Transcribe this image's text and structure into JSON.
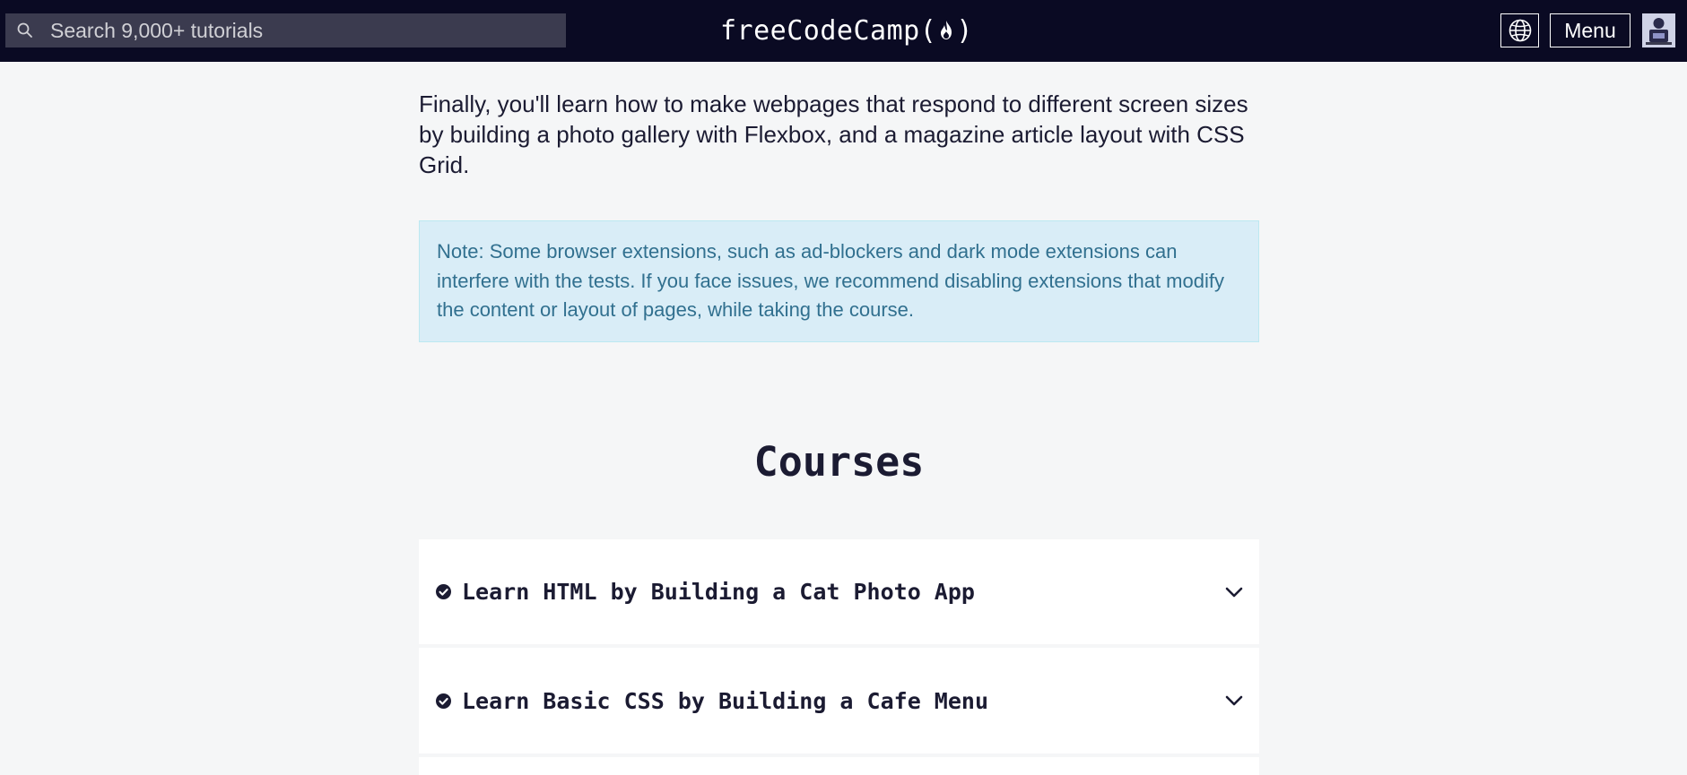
{
  "nav": {
    "search_placeholder": "Search 9,000+ tutorials",
    "logo_text_left": "freeCodeCamp(",
    "logo_text_right": ")",
    "menu_label": "Menu"
  },
  "content": {
    "intro": "Finally, you'll learn how to make webpages that respond to different screen sizes by building a photo gallery with Flexbox, and a magazine article layout with CSS Grid.",
    "note": "Note: Some browser extensions, such as ad-blockers and dark mode extensions can interfere with the tests. If you face issues, we recommend disabling extensions that modify the content or layout of pages, while taking the course."
  },
  "courses": {
    "heading": "Courses",
    "items": [
      {
        "title": "Learn HTML by Building a Cat Photo App",
        "completed": true
      },
      {
        "title": "Learn Basic CSS by Building a Cafe Menu",
        "completed": true
      }
    ]
  },
  "colors": {
    "nav_bg": "#0a0a23",
    "page_bg": "#f5f6f7",
    "note_bg": "#d9edf7",
    "note_text": "#31708f"
  },
  "icons": [
    "search-icon",
    "flame-icon",
    "globe-icon",
    "avatar",
    "check-circle-icon",
    "chevron-down-icon"
  ]
}
